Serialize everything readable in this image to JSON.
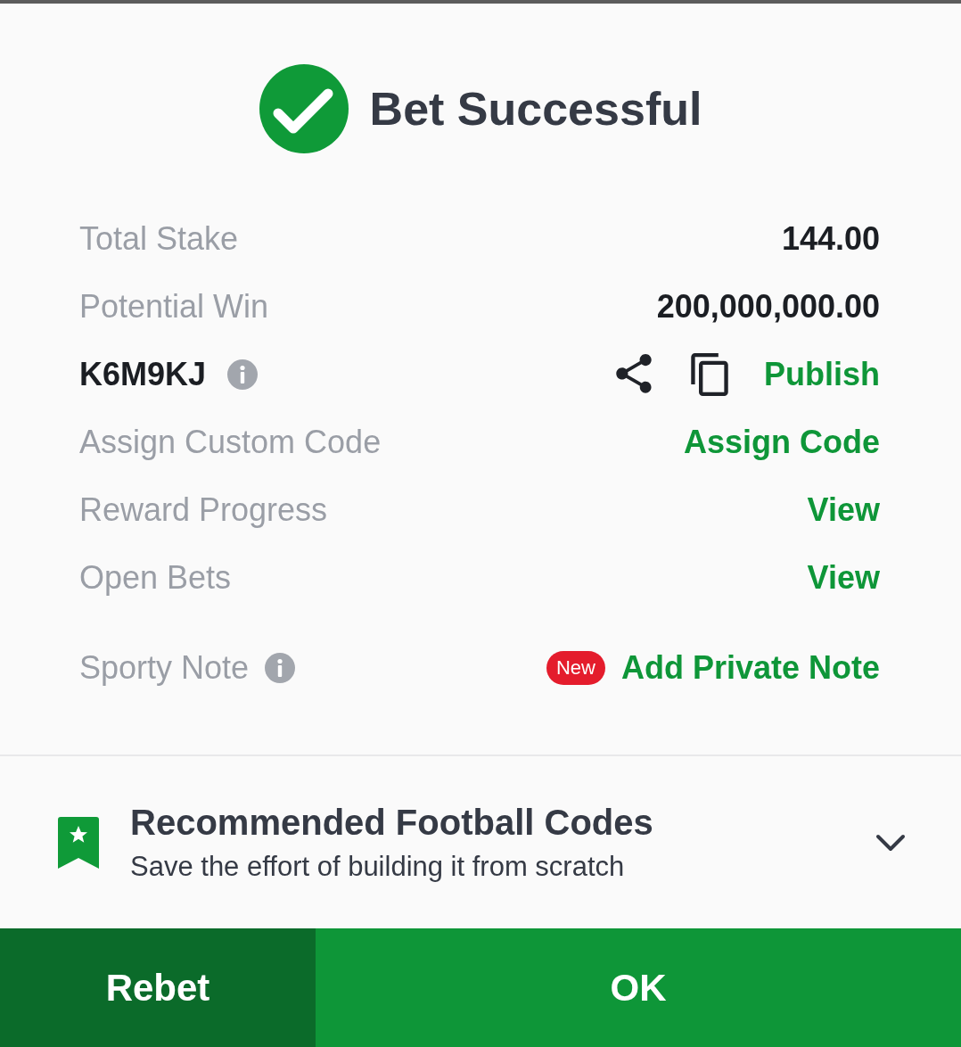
{
  "header": {
    "title": "Bet Successful"
  },
  "rows": [
    {
      "kind": "value",
      "label": "Total Stake",
      "value": "144.00"
    },
    {
      "kind": "value",
      "label": "Potential Win",
      "value": "200,000,000.00"
    },
    {
      "kind": "code",
      "code": "K6M9KJ",
      "action": "Publish"
    },
    {
      "kind": "link",
      "label": "Assign Custom Code",
      "action": "Assign Code"
    },
    {
      "kind": "link",
      "label": "Reward Progress",
      "action": "View"
    },
    {
      "kind": "link",
      "label": "Open Bets",
      "action": "View"
    },
    {
      "kind": "note",
      "label": "Sporty Note",
      "badge": "New",
      "action": "Add Private Note"
    }
  ],
  "recommendation": {
    "title": "Recommended Football Codes",
    "subtitle": "Save the effort of building it from scratch",
    "expanded": false
  },
  "buttons": [
    {
      "kind": "secondary",
      "label": "Rebet"
    },
    {
      "kind": "primary",
      "label": "OK"
    }
  ]
}
